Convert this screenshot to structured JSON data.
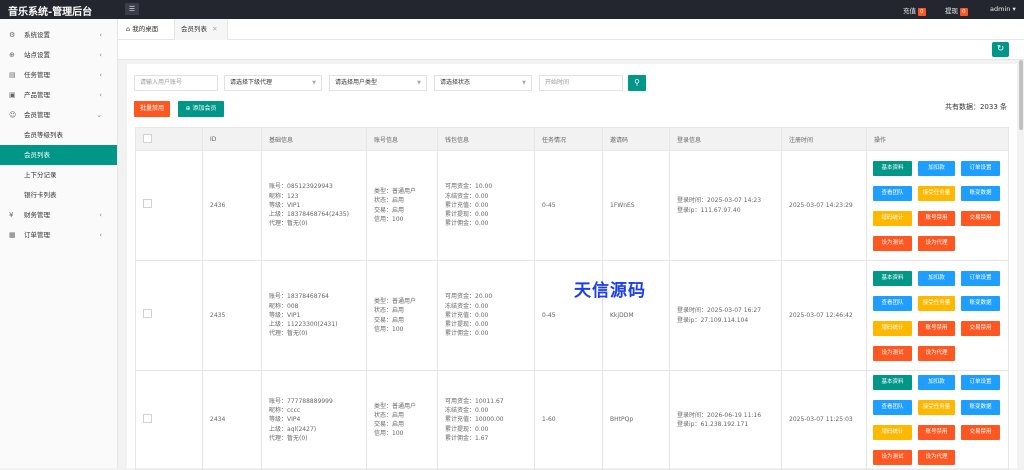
{
  "app_title": "音乐系统-管理后台",
  "topbar": {
    "menu_icon": "hamburger-icon",
    "recharge_label": "充值",
    "recharge_count": "0",
    "withdraw_label": "提现",
    "withdraw_count": "0",
    "user": "admin"
  },
  "sidebar": {
    "items": [
      {
        "label": "系统设置",
        "icon": "gear-icon"
      },
      {
        "label": "站点设置",
        "icon": "globe-icon"
      },
      {
        "label": "任务管理",
        "icon": "doc-icon"
      },
      {
        "label": "产品管理",
        "icon": "box-icon"
      },
      {
        "label": "会员管理",
        "icon": "user-icon"
      }
    ],
    "sub_items": [
      "会员等级列表",
      "会员列表",
      "上下分记录",
      "银行卡列表"
    ],
    "items_after": [
      {
        "label": "财务管理",
        "icon": "yen-icon"
      },
      {
        "label": "订单管理",
        "icon": "grid-icon"
      }
    ]
  },
  "tabs": {
    "home": "我的桌面",
    "active": "会员列表"
  },
  "filters": {
    "account_placeholder": "请输入用户账号",
    "agent": "请选择下级代理",
    "user_type": "请选择用户类型",
    "status": "请选择状态",
    "start_time_placeholder": "开始时间"
  },
  "actions": {
    "batch_disable": "批量禁用",
    "add_member": "添加会员"
  },
  "total_text": "共有数据：2033 条",
  "columns": [
    "ID",
    "基础信息",
    "账号信息",
    "钱包信息",
    "任务情况",
    "邀请码",
    "登录信息",
    "注册时间",
    "操作"
  ],
  "op_buttons": [
    "基本资料",
    "加扣款",
    "订单设置",
    "查看团队",
    "接受任务量",
    "账变数据",
    "增码统计",
    "账号禁用",
    "交易禁用",
    "设为测试",
    "设为代理"
  ],
  "rows": [
    {
      "id": "2436",
      "basic": [
        "账号：085123929943",
        "昵称：123",
        "等级：VIP1",
        "上级：18378468764(2435)",
        "代理：暂无(0)"
      ],
      "account": [
        "类型：普通用户",
        "状态：启用",
        "交易：启用",
        "信用：100"
      ],
      "wallet": [
        "可用资金：10.00",
        "冻结资金：0.00",
        "累计充值：0.00",
        "累计提现：0.00",
        "累计佣金：0.00"
      ],
      "task": "0-45",
      "invite": "1FWnES",
      "login": [
        "登录时间：2025-03-07 14:23",
        "登录ip：111.67.97.40"
      ],
      "reg": "2025-03-07 14:23:29"
    },
    {
      "id": "2435",
      "basic": [
        "账号：18378468764",
        "昵称：008",
        "等级：VIP1",
        "上级：11223300(2431)",
        "代理：暂无(0)"
      ],
      "account": [
        "类型：普通用户",
        "状态：启用",
        "交易：启用",
        "信用：100"
      ],
      "wallet": [
        "可用资金：20.00",
        "冻结资金：0.00",
        "累计充值：0.00",
        "累计提现：0.00",
        "累计佣金：0.00"
      ],
      "task": "0-45",
      "invite": "KkjDDM",
      "login": [
        "登录时间：2025-03-07 16:27",
        "登录ip：27.109.114.104"
      ],
      "reg": "2025-03-07 12:46:42"
    },
    {
      "id": "2434",
      "basic": [
        "账号：777788889999",
        "昵称：cccc",
        "等级：VIP4",
        "上级：aql(2427)",
        "代理：暂无(0)"
      ],
      "account": [
        "类型：普通用户",
        "状态：启用",
        "交易：启用",
        "信用：100"
      ],
      "wallet": [
        "可用资金：10011.67",
        "冻结资金：0.00",
        "累计充值：10000.00",
        "累计提现：0.00",
        "累计佣金：1.67"
      ],
      "task": "1-60",
      "invite": "BHtPQp",
      "login": [
        "登录时间：2026-06-19 11:16",
        "登录ip：61.238.192.171"
      ],
      "reg": "2025-03-07 11:25:03"
    }
  ],
  "watermark": "天信源码"
}
